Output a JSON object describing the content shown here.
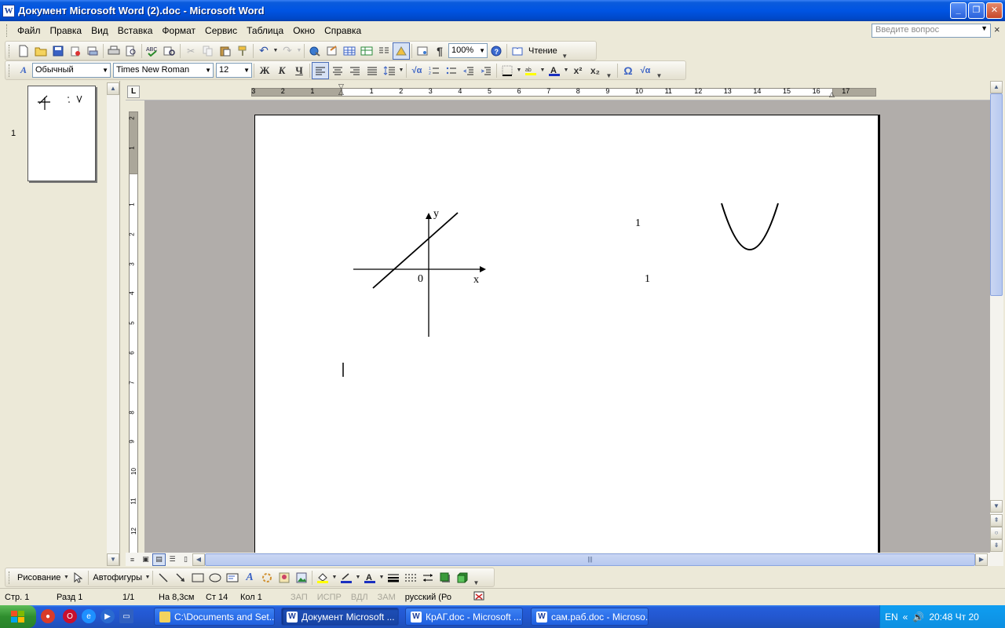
{
  "window": {
    "title": "Документ Microsoft Word (2).doc - Microsoft Word",
    "app_icon": "W",
    "minimize_label": "_",
    "maximize_label": "❐",
    "close_label": "✕"
  },
  "menu": {
    "items": [
      "Файл",
      "Правка",
      "Вид",
      "Вставка",
      "Формат",
      "Сервис",
      "Таблица",
      "Окно",
      "Справка"
    ],
    "ask_placeholder": "Введите вопрос",
    "doc_close": "×"
  },
  "standard_toolbar": {
    "zoom": "100%",
    "read_label": "Чтение",
    "pilcrow": "¶"
  },
  "format_toolbar": {
    "style": "Обычный",
    "font": "Times New Roman",
    "size": "12",
    "bold": "Ж",
    "italic": "К",
    "underline": "Ч",
    "omega": "Ω",
    "sqrt": "√α"
  },
  "ruler": {
    "left_numbers": [
      "3",
      "2",
      "1"
    ],
    "right_numbers": [
      "1",
      "2",
      "3",
      "4",
      "5",
      "6",
      "7",
      "8",
      "9",
      "10",
      "11",
      "12",
      "13",
      "14",
      "15",
      "16",
      "17"
    ],
    "vertical_top": [
      "2",
      "1"
    ],
    "vertical_numbers": [
      "1",
      "2",
      "3",
      "4",
      "5",
      "6",
      "7",
      "8",
      "9",
      "10",
      "11",
      "12"
    ],
    "corner": "L"
  },
  "thumbnail": {
    "page_number": "1"
  },
  "document": {
    "axis_y": "y",
    "axis_x": "x",
    "origin": "0",
    "label_top": "1",
    "label_bottom": "1"
  },
  "drawing_toolbar": {
    "drawing_label": "Рисование",
    "autoshapes_label": "Автофигуры"
  },
  "status": {
    "page": "Стр. 1",
    "section": "Разд 1",
    "pages": "1/1",
    "at": "На 8,3см",
    "line": "Ст 14",
    "col": "Кол 1",
    "rec": "ЗАП",
    "trk": "ИСПР",
    "ext": "ВДЛ",
    "ovr": "ЗАМ",
    "lang": "русский (Ро"
  },
  "taskbar": {
    "tasks": [
      "C:\\Documents and Set...",
      "Документ Microsoft ...",
      "КрАГ.doc - Microsoft ...",
      "сам.раб.doc - Microso..."
    ],
    "lang": "EN",
    "chevron": "«",
    "clock": "20:48 Чт 20"
  },
  "colors": {
    "titlebar": "#0054e3",
    "taskbar": "#245edb",
    "start": "#3a9a3a",
    "doc_bg": "#b1adaa"
  }
}
